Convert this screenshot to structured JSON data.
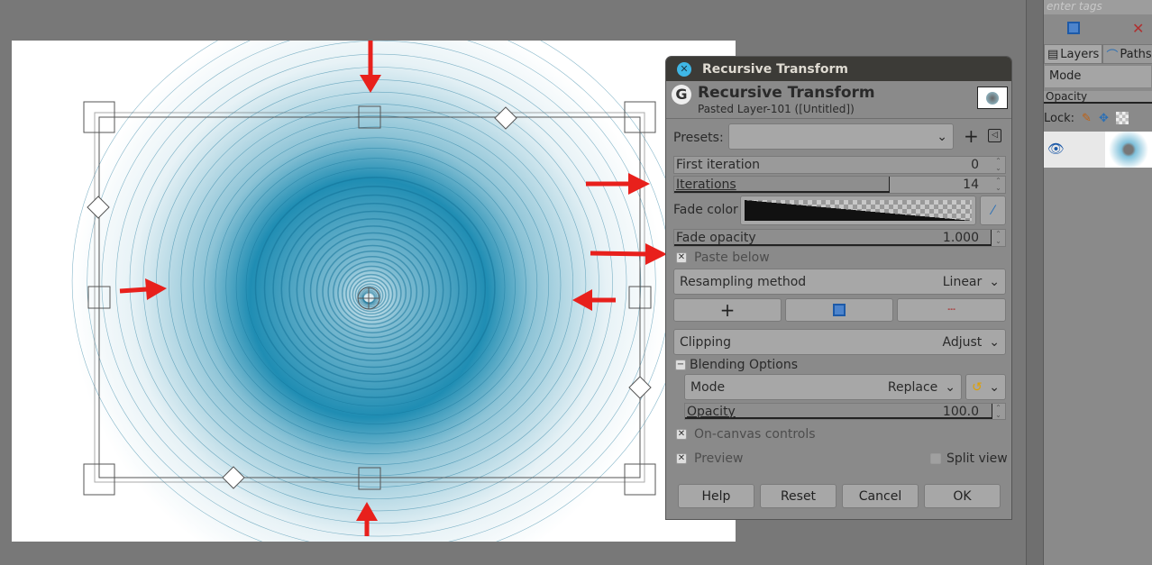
{
  "dialog": {
    "window_title": "Recursive Transform",
    "header_title": "Recursive Transform",
    "header_subtitle": "Pasted Layer-101 ([Untitled])",
    "presets_label": "Presets:",
    "presets_value": "",
    "first_iteration": {
      "label": "First iteration",
      "value": "0"
    },
    "iterations": {
      "label": "Iterations",
      "value": "14",
      "fill_percent": 65
    },
    "fade_color_label": "Fade color",
    "fade_opacity": {
      "label": "Fade opacity",
      "value": "1.000",
      "fill_percent": 100
    },
    "paste_below": {
      "label": "Paste below",
      "checked": true
    },
    "resampling": {
      "label": "Resampling method",
      "value": "Linear"
    },
    "clipping": {
      "label": "Clipping",
      "value": "Adjust"
    },
    "blending_label": "Blending Options",
    "mode": {
      "label": "Mode",
      "value": "Replace"
    },
    "opacity": {
      "label": "Opacity",
      "value": "100.0",
      "fill_percent": 100
    },
    "on_canvas": {
      "label": "On-canvas controls",
      "checked": true
    },
    "preview": {
      "label": "Preview",
      "checked": true
    },
    "split_view": {
      "label": "Split view",
      "checked": false
    },
    "buttons": {
      "help": "Help",
      "reset": "Reset",
      "cancel": "Cancel",
      "ok": "OK"
    }
  },
  "dock": {
    "tags_placeholder": "enter tags",
    "tabs": [
      "Layers",
      "Paths"
    ],
    "mode_label": "Mode",
    "opacity_label": "Opacity",
    "lock_label": "Lock:"
  },
  "colors": {
    "accent": "#3fb7e6",
    "arrow": "#e8201c",
    "tunnel": "#1a8ab0"
  }
}
